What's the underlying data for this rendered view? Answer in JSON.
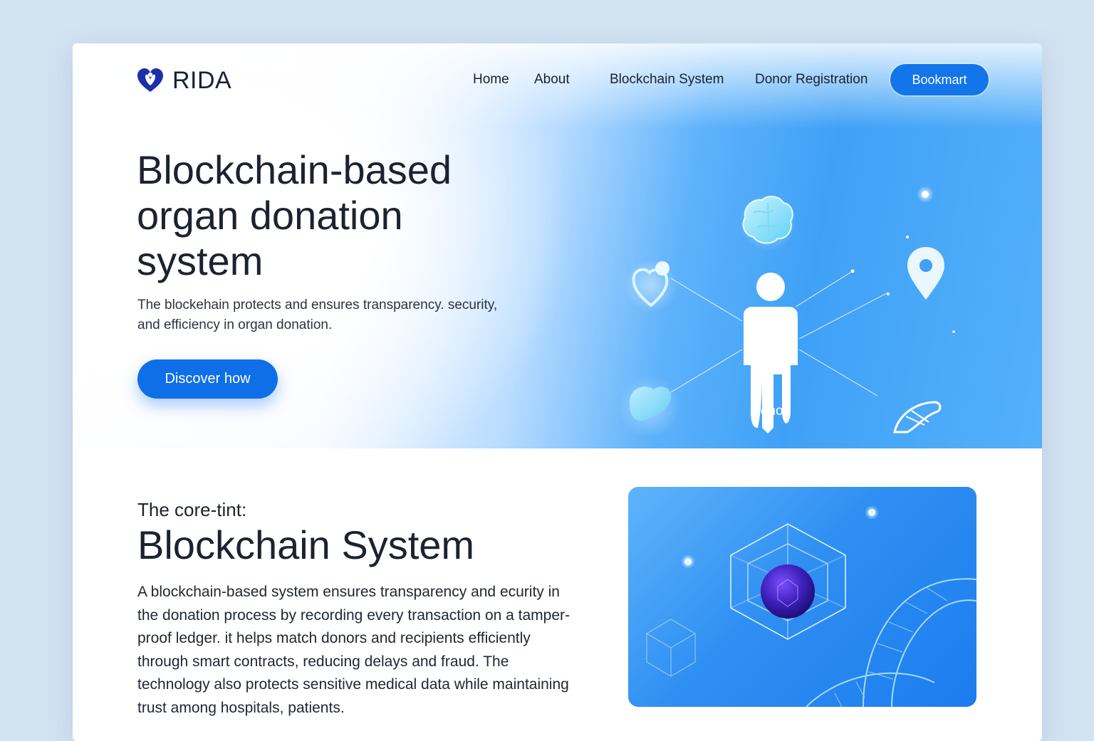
{
  "brand": {
    "name": "RIDA"
  },
  "nav": {
    "items": [
      "Home",
      "About",
      "Blockchain System",
      "Donor Registration"
    ],
    "cta_label": "Bookmart"
  },
  "hero": {
    "title": "Blockchain-based organ donation system",
    "subtitle": "The blockehain protects and ensures transparency. security, and efficiency in organ donation.",
    "cta_label": "Discover how",
    "illustration_label": "Donor",
    "icons": [
      "brain-icon",
      "heart-icon",
      "location-pin-icon",
      "person-icon",
      "liver-icon",
      "pancreas-icon"
    ]
  },
  "section": {
    "pretitle": "The core-tint:",
    "title": "Blockchain System",
    "body": "A blockchain-based system ensures transparency and ecurity in the donation process by recording every transaction on a tamper-proof ledger. it helps match donors and recipients efficiently through smart contracts, reducing delays and fraud. The technology also protects sensitive medical data while maintaining trust among hospitals, patients.",
    "illustration_icons": [
      "cube-icon",
      "dna-icon"
    ]
  },
  "colors": {
    "background": "#d3e3f2",
    "accent": "#1275ea",
    "hero_blue": "#3fa1f6",
    "text": "#1c2230"
  }
}
